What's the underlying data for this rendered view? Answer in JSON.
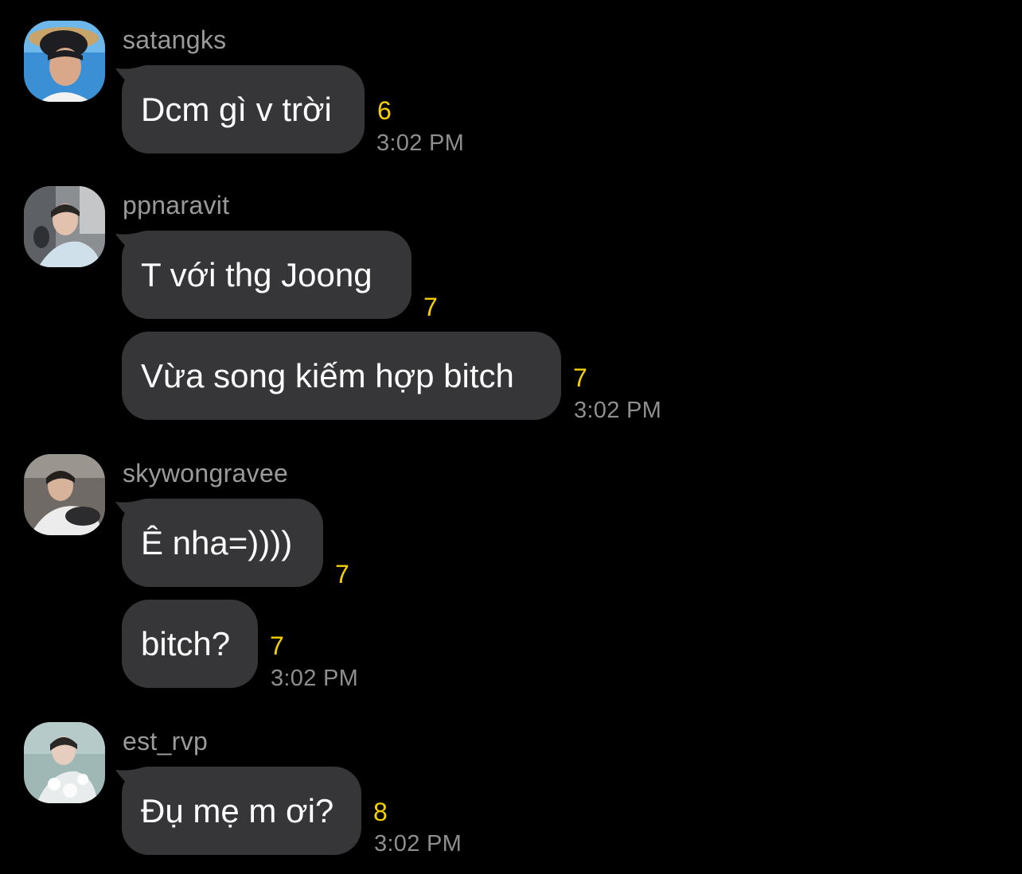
{
  "colors": {
    "background": "#000000",
    "bubble": "#363638",
    "username": "#9a9a9a",
    "read_count": "#f5d000",
    "timestamp": "#8e8e8e"
  },
  "groups": [
    {
      "username": "satangks",
      "avatar": "avatar-photo",
      "messages": [
        {
          "text": "Dcm gì v trời",
          "count": "6"
        }
      ],
      "time": "3:02 PM"
    },
    {
      "username": "ppnaravit",
      "avatar": "avatar-photo",
      "messages": [
        {
          "text": "T với thg Joong",
          "count": "7"
        },
        {
          "text": "Vừa song kiếm hợp bitch",
          "count": "7"
        }
      ],
      "time": "3:02 PM"
    },
    {
      "username": "skywongravee",
      "avatar": "avatar-photo",
      "messages": [
        {
          "text": "Ê nha=))))",
          "count": "7"
        },
        {
          "text": "bitch?",
          "count": "7"
        }
      ],
      "time": "3:02 PM"
    },
    {
      "username": "est_rvp",
      "avatar": "avatar-photo",
      "messages": [
        {
          "text": "Đụ mẹ m ơi?",
          "count": "8"
        }
      ],
      "time": "3:02 PM"
    }
  ]
}
